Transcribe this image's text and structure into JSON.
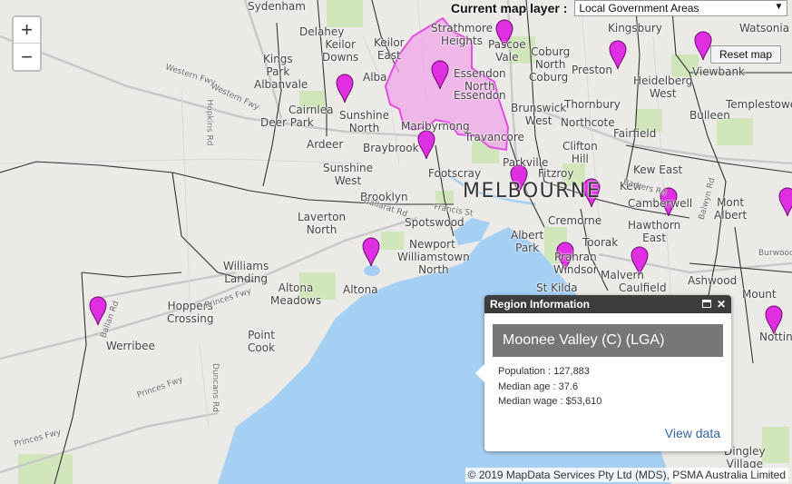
{
  "layer_bar": {
    "label": "Current map layer :",
    "selected": "Local Government Areas",
    "arrow": "▼"
  },
  "zoom": {
    "in": "+",
    "out": "−"
  },
  "reset": {
    "label": "Reset map"
  },
  "popup": {
    "header": "Region Information",
    "title": "Moonee Valley (C) (LGA)",
    "rows": [
      "Population : 127,883",
      "Median age : 37.6",
      "Median wage : $53,610"
    ],
    "link": "View data",
    "close": "✕"
  },
  "attribution": "© 2019 MapData Services Pty Ltd (MDS), PSMA Australia Limited",
  "colors": {
    "land": "#eceae6",
    "water": "#a6cff4",
    "park": "#cfe5b6",
    "highlight_fill": "#f0a6e8",
    "highlight_stroke": "#e44ee0",
    "marker": "#e02ee3",
    "boundary": "#333333"
  },
  "map_labels": [
    {
      "text": "Sydenham"
    },
    {
      "text": "Delahey"
    },
    {
      "text": "Keilor\nDowns"
    },
    {
      "text": "Keilor\nEast"
    },
    {
      "text": "Strathmore\nHeights"
    },
    {
      "text": "Pascoe\nVale"
    },
    {
      "text": "Coburg\nNorth"
    },
    {
      "text": "Kingsbury"
    },
    {
      "text": "Watsonia"
    },
    {
      "text": "Kings\nPark"
    },
    {
      "text": "Albanvale"
    },
    {
      "text": "Essendon\nNorth"
    },
    {
      "text": "Essendon"
    },
    {
      "text": "Coburg"
    },
    {
      "text": "Preston"
    },
    {
      "text": "Heidelberg\nWest"
    },
    {
      "text": "Viewbank"
    },
    {
      "text": "Cairnlea"
    },
    {
      "text": "Sunshine\nNorth"
    },
    {
      "text": "Brunswick\nWest"
    },
    {
      "text": "Thornbury"
    },
    {
      "text": "Northcote"
    },
    {
      "text": "Fairfield"
    },
    {
      "text": "Bulleen"
    },
    {
      "text": "Templestowe"
    },
    {
      "text": "Deer Park"
    },
    {
      "text": "Maribyrnong"
    },
    {
      "text": "Travancore"
    },
    {
      "text": "Ardeer"
    },
    {
      "text": "Braybrook"
    },
    {
      "text": "Clifton\nHill"
    },
    {
      "text": "Sunshine\nWest"
    },
    {
      "text": "Footscray"
    },
    {
      "text": "Parkville"
    },
    {
      "text": "Fitzroy"
    },
    {
      "text": "Kew East"
    },
    {
      "text": "Kew"
    },
    {
      "text": "MELBOURNE"
    },
    {
      "text": "Brooklyn"
    },
    {
      "text": "Camberwell"
    },
    {
      "text": "Hawthorn\nEast"
    },
    {
      "text": "Mont\nAlbert"
    },
    {
      "text": "Laverton\nNorth"
    },
    {
      "text": "Spotswood"
    },
    {
      "text": "Cremorne"
    },
    {
      "text": "Albert\nPark"
    },
    {
      "text": "Toorak"
    },
    {
      "text": "Newport"
    },
    {
      "text": "Williamstown\nNorth"
    },
    {
      "text": "Prahran\nWindsor"
    },
    {
      "text": "Malvern"
    },
    {
      "text": "Caulfield"
    },
    {
      "text": "Ashwood"
    },
    {
      "text": "Williams\nLanding"
    },
    {
      "text": "Altona\nMeadows"
    },
    {
      "text": "Altona"
    },
    {
      "text": "St Kilda"
    },
    {
      "text": "Mount"
    },
    {
      "text": "Hoppers\nCrossing"
    },
    {
      "text": "Point\nCook"
    },
    {
      "text": "Werribee"
    },
    {
      "text": "Notting"
    },
    {
      "text": "Dingley\nVillage"
    },
    {
      "text": "Alba"
    },
    {
      "text": "Western Fwy"
    },
    {
      "text": "Western Fwy"
    },
    {
      "text": "Princes Fwy"
    },
    {
      "text": "Princes Fwy"
    },
    {
      "text": "Princes Fwy"
    },
    {
      "text": "Hopkins Rd"
    },
    {
      "text": "Duncans Rd"
    },
    {
      "text": "Ballarat Rd"
    },
    {
      "text": "Francis St"
    },
    {
      "text": "Balwyn Rd"
    },
    {
      "text": "Barkers Rd"
    },
    {
      "text": "Burwood Hwy"
    },
    {
      "text": "Ballan Rd"
    }
  ]
}
